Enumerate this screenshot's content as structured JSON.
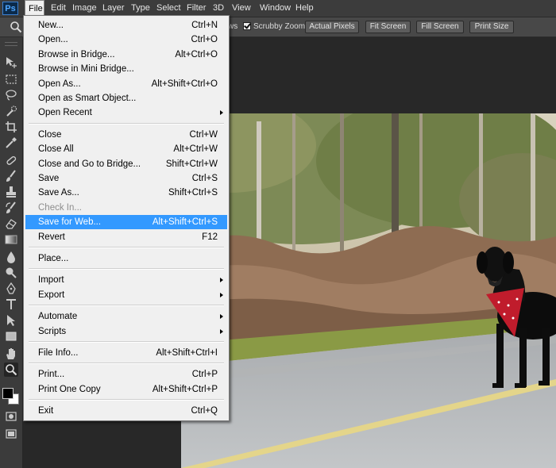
{
  "app": {
    "logo": "Ps"
  },
  "menubar": {
    "items": [
      "File",
      "Edit",
      "Image",
      "Layer",
      "Type",
      "Select",
      "Filter",
      "3D",
      "View",
      "Window",
      "Help"
    ],
    "active": "File"
  },
  "optionsbar": {
    "partial_text": "ws",
    "scrubby_zoom_label": "Scrubby Zoom",
    "scrubby_zoom_checked": true,
    "buttons": [
      "Actual Pixels",
      "Fit Screen",
      "Fill Screen",
      "Print Size"
    ]
  },
  "tools": {
    "icons": [
      "move-icon",
      "marquee-icon",
      "lasso-icon",
      "quick-select-icon",
      "crop-icon",
      "eyedropper-icon",
      "healing-brush-icon",
      "brush-icon",
      "clone-stamp-icon",
      "history-brush-icon",
      "eraser-icon",
      "gradient-icon",
      "blur-icon",
      "dodge-icon",
      "pen-icon",
      "type-icon",
      "path-select-icon",
      "rectangle-icon",
      "hand-icon",
      "zoom-icon"
    ],
    "active": "zoom-icon",
    "foreground_color": "#000000",
    "background_color": "#ffffff"
  },
  "file_menu": {
    "items": [
      {
        "label": "New...",
        "shortcut": "Ctrl+N"
      },
      {
        "label": "Open...",
        "shortcut": "Ctrl+O"
      },
      {
        "label": "Browse in Bridge...",
        "shortcut": "Alt+Ctrl+O"
      },
      {
        "label": "Browse in Mini Bridge...",
        "shortcut": ""
      },
      {
        "label": "Open As...",
        "shortcut": "Alt+Shift+Ctrl+O"
      },
      {
        "label": "Open as Smart Object...",
        "shortcut": ""
      },
      {
        "label": "Open Recent",
        "shortcut": "",
        "submenu": true
      },
      {
        "separator": true
      },
      {
        "label": "Close",
        "shortcut": "Ctrl+W"
      },
      {
        "label": "Close All",
        "shortcut": "Alt+Ctrl+W"
      },
      {
        "label": "Close and Go to Bridge...",
        "shortcut": "Shift+Ctrl+W"
      },
      {
        "label": "Save",
        "shortcut": "Ctrl+S"
      },
      {
        "label": "Save As...",
        "shortcut": "Shift+Ctrl+S"
      },
      {
        "label": "Check In...",
        "shortcut": "",
        "disabled": true
      },
      {
        "label": "Save for Web...",
        "shortcut": "Alt+Shift+Ctrl+S",
        "highlighted": true
      },
      {
        "label": "Revert",
        "shortcut": "F12"
      },
      {
        "separator": true
      },
      {
        "label": "Place...",
        "shortcut": ""
      },
      {
        "separator": true
      },
      {
        "label": "Import",
        "shortcut": "",
        "submenu": true
      },
      {
        "label": "Export",
        "shortcut": "",
        "submenu": true
      },
      {
        "separator": true
      },
      {
        "label": "Automate",
        "shortcut": "",
        "submenu": true
      },
      {
        "label": "Scripts",
        "shortcut": "",
        "submenu": true
      },
      {
        "separator": true
      },
      {
        "label": "File Info...",
        "shortcut": "Alt+Shift+Ctrl+I"
      },
      {
        "separator": true
      },
      {
        "label": "Print...",
        "shortcut": "Ctrl+P"
      },
      {
        "label": "Print One Copy",
        "shortcut": "Alt+Shift+Ctrl+P"
      },
      {
        "separator": true
      },
      {
        "label": "Exit",
        "shortcut": "Ctrl+Q"
      }
    ]
  },
  "colors": {
    "menu_highlight": "#3399ff",
    "menubar_bg": "#3c3c3c",
    "workspace_bg": "#282828"
  }
}
